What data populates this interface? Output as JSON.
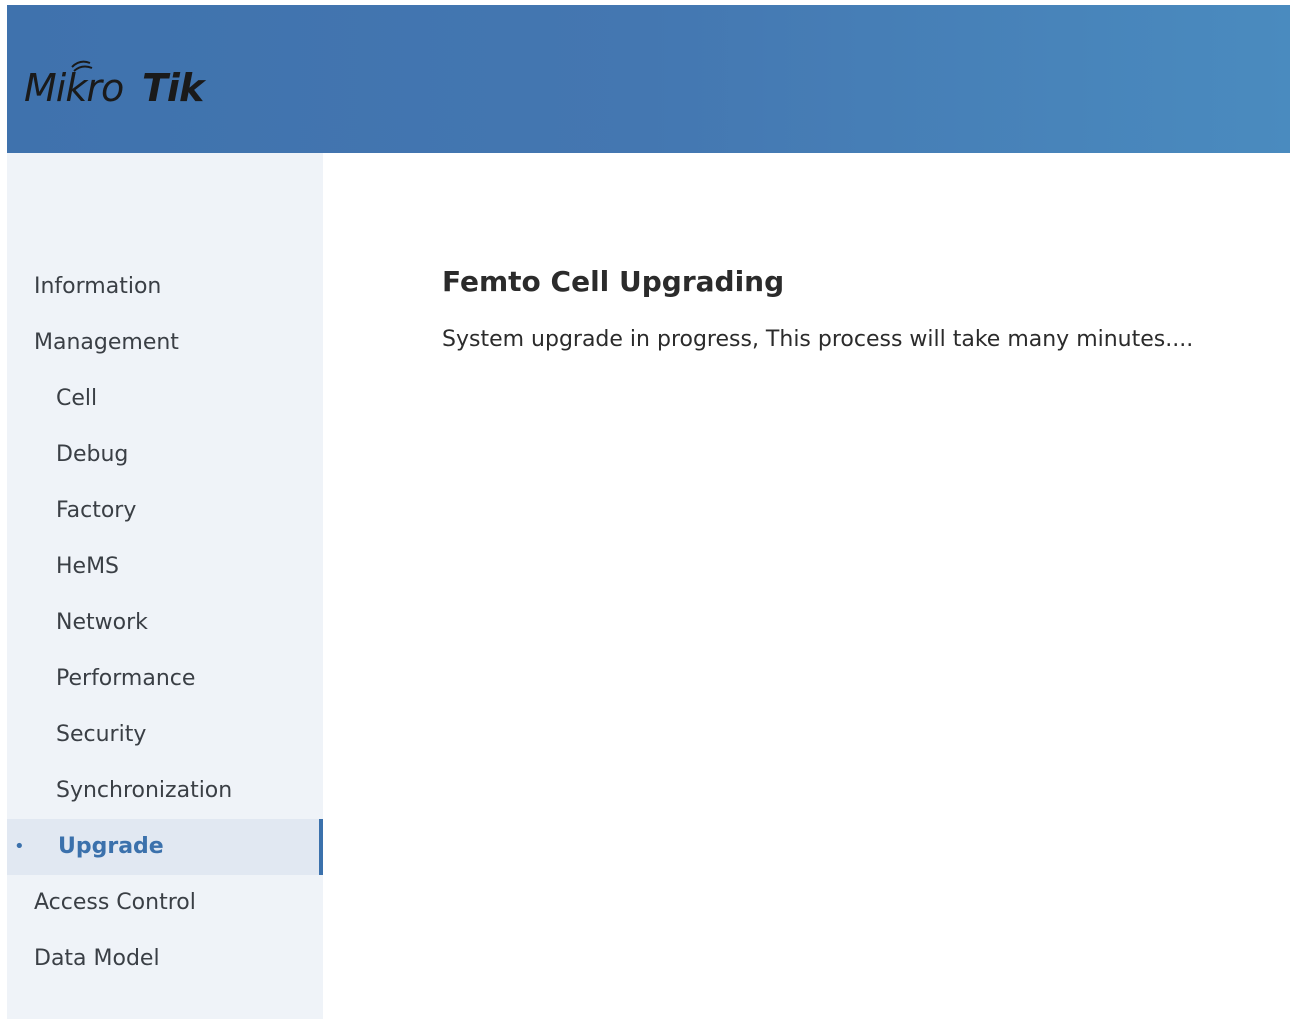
{
  "header": {
    "brand": "MikroTik",
    "colors": {
      "header_start": "#3f72ad",
      "header_end": "#4a8bbf",
      "accent": "#3b71ac",
      "sidebar_bg": "#eff3f8"
    }
  },
  "sidebar": {
    "items": [
      {
        "label": "Information",
        "level": "top"
      },
      {
        "label": "Management",
        "level": "top"
      },
      {
        "label": "Cell",
        "level": "sub"
      },
      {
        "label": "Debug",
        "level": "sub"
      },
      {
        "label": "Factory",
        "level": "sub"
      },
      {
        "label": "HeMS",
        "level": "sub"
      },
      {
        "label": "Network",
        "level": "sub"
      },
      {
        "label": "Performance",
        "level": "sub"
      },
      {
        "label": "Security",
        "level": "sub"
      },
      {
        "label": "Synchronization",
        "level": "sub"
      },
      {
        "label": "Upgrade",
        "level": "sub",
        "active": true
      },
      {
        "label": "Access Control",
        "level": "top"
      },
      {
        "label": "Data Model",
        "level": "top"
      }
    ],
    "active_bullet": "•"
  },
  "main": {
    "title": "Femto Cell Upgrading",
    "message": "System upgrade in progress, This process will take many minutes...."
  }
}
